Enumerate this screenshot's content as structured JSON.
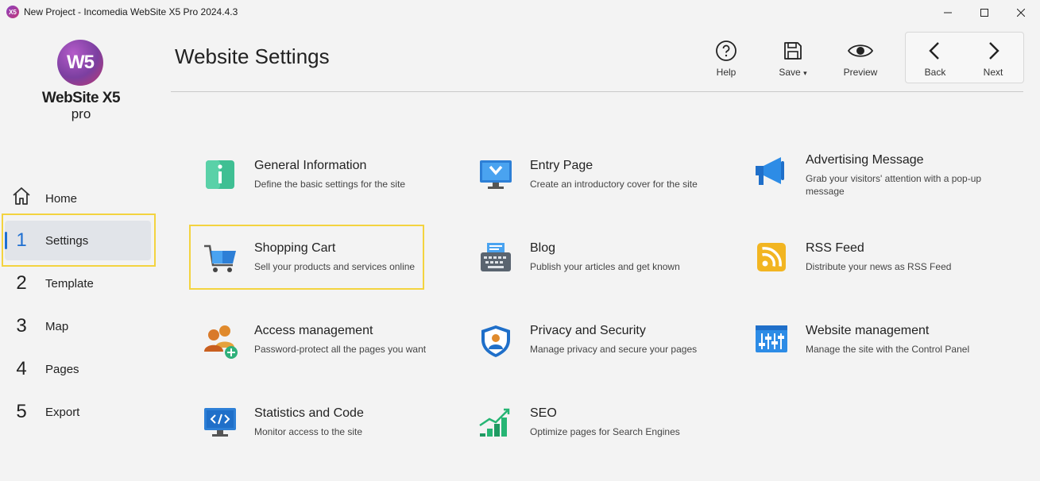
{
  "window": {
    "title": "New Project - Incomedia WebSite X5 Pro 2024.4.3",
    "app_icon_text": "X5"
  },
  "logo": {
    "mark": "W5",
    "name": "WebSite X5",
    "edition": "pro"
  },
  "sidebar": {
    "home_label": "Home",
    "items": [
      {
        "num": "1",
        "label": "Settings",
        "active": true
      },
      {
        "num": "2",
        "label": "Template"
      },
      {
        "num": "3",
        "label": "Map"
      },
      {
        "num": "4",
        "label": "Pages"
      },
      {
        "num": "5",
        "label": "Export"
      }
    ],
    "collapse_glyph": "‹"
  },
  "header": {
    "title": "Website Settings",
    "help_label": "Help",
    "save_label": "Save",
    "save_caret": "▾",
    "preview_label": "Preview",
    "back_label": "Back",
    "next_label": "Next"
  },
  "settings": [
    {
      "title": "General Information",
      "desc": "Define the basic settings for the site",
      "icon": "info-icon"
    },
    {
      "title": "Entry Page",
      "desc": "Create an introductory cover for the site",
      "icon": "monitor-download-icon"
    },
    {
      "title": "Advertising Message",
      "desc": "Grab your visitors' attention with a pop-up message",
      "icon": "megaphone-icon"
    },
    {
      "title": "Shopping Cart",
      "desc": "Sell your products and services online",
      "icon": "cart-icon"
    },
    {
      "title": "Blog",
      "desc": "Publish your articles and get known",
      "icon": "typewriter-icon"
    },
    {
      "title": "RSS Feed",
      "desc": "Distribute your news as RSS Feed",
      "icon": "rss-icon"
    },
    {
      "title": "Access management",
      "desc": "Password-protect all the pages you want",
      "icon": "users-add-icon"
    },
    {
      "title": "Privacy and Security",
      "desc": "Manage privacy and secure your pages",
      "icon": "shield-user-icon"
    },
    {
      "title": "Website management",
      "desc": "Manage the site with the Control Panel",
      "icon": "control-panel-icon"
    },
    {
      "title": "Statistics and Code",
      "desc": "Monitor access to the site",
      "icon": "code-monitor-icon"
    },
    {
      "title": "SEO",
      "desc": "Optimize pages for Search Engines",
      "icon": "seo-chart-icon"
    }
  ],
  "colors": {
    "accent": "#1e6fd1",
    "highlight": "#f3d33f"
  }
}
